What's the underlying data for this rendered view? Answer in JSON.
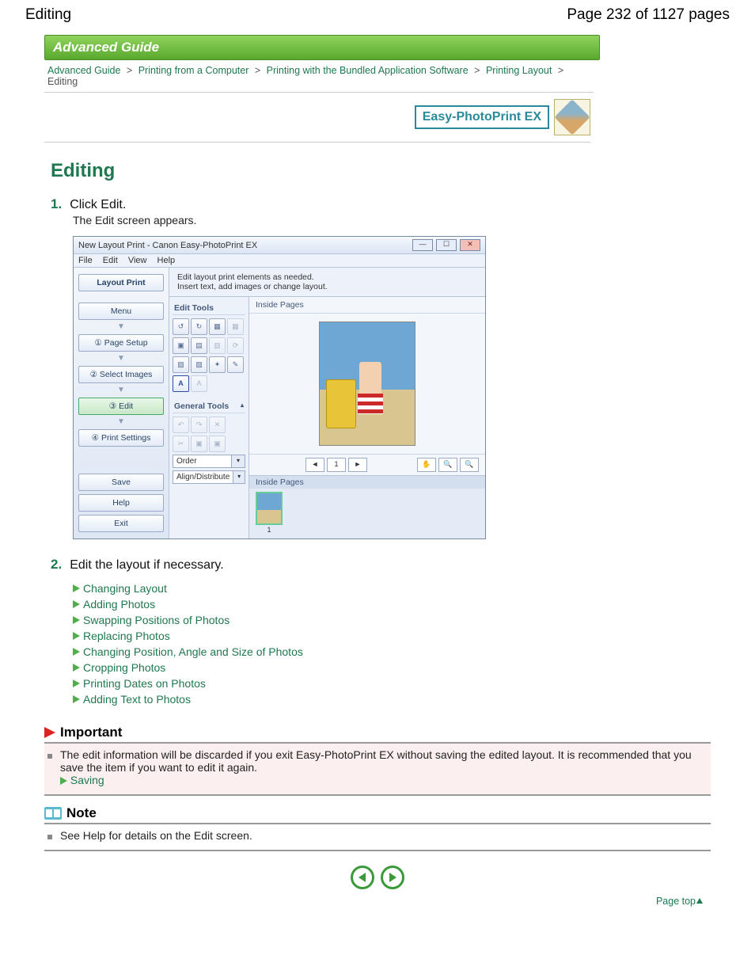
{
  "header": {
    "title_left": "Editing",
    "page_indicator": "Page 232 of 1127 pages"
  },
  "banner": "Advanced Guide",
  "breadcrumb": {
    "items": [
      {
        "label": "Advanced Guide",
        "link": true
      },
      {
        "label": "Printing from a Computer",
        "link": true
      },
      {
        "label": "Printing with the Bundled Application Software",
        "link": true
      },
      {
        "label": "Printing Layout",
        "link": true
      }
    ],
    "current": "Editing",
    "separator": ">"
  },
  "brand": "Easy-PhotoPrint EX",
  "page_title": "Editing",
  "steps": {
    "s1": {
      "num": "1.",
      "head": "Click Edit.",
      "sub": "The Edit screen appears."
    },
    "s2": {
      "num": "2.",
      "head": "Edit the layout if necessary."
    }
  },
  "screenshot": {
    "window_title": "New Layout Print - Canon Easy-PhotoPrint EX",
    "menus": {
      "file": "File",
      "edit": "Edit",
      "view": "View",
      "help": "Help"
    },
    "left_panel": {
      "mode": "Layout Print",
      "menu_label": "Menu",
      "items": {
        "page_setup": "①  Page Setup",
        "select_images": "②  Select Images",
        "edit": "③          Edit",
        "print_settings": "④  Print Settings"
      },
      "save": "Save",
      "help": "Help",
      "exit": "Exit"
    },
    "instruction": "Edit layout print elements as needed.\nInsert text, add images or change layout.",
    "tools": {
      "edit_header": "Edit Tools",
      "general_header": "General Tools",
      "order": "Order",
      "align": "Align/Distribute"
    },
    "canvas_header": "Inside Pages",
    "nav": {
      "prev": "◄",
      "page": "1",
      "next": "►",
      "hand": "✋",
      "zin": "🔍",
      "zout": "🔍"
    },
    "tray_header": "Inside Pages",
    "thumb_label": "1"
  },
  "edit_links": [
    "Changing Layout",
    "Adding Photos",
    "Swapping Positions of Photos",
    "Replacing Photos",
    "Changing Position, Angle and Size of Photos",
    "Cropping Photos",
    "Printing Dates on Photos",
    "Adding Text to Photos"
  ],
  "important": {
    "header": "Important",
    "text": "The edit information will be discarded if you exit Easy-PhotoPrint EX without saving the edited layout. It is recommended that you save the item if you want to edit it again.",
    "saving_link": "Saving"
  },
  "note": {
    "header": "Note",
    "text": "See Help for details on the Edit screen."
  },
  "page_top": "Page top"
}
